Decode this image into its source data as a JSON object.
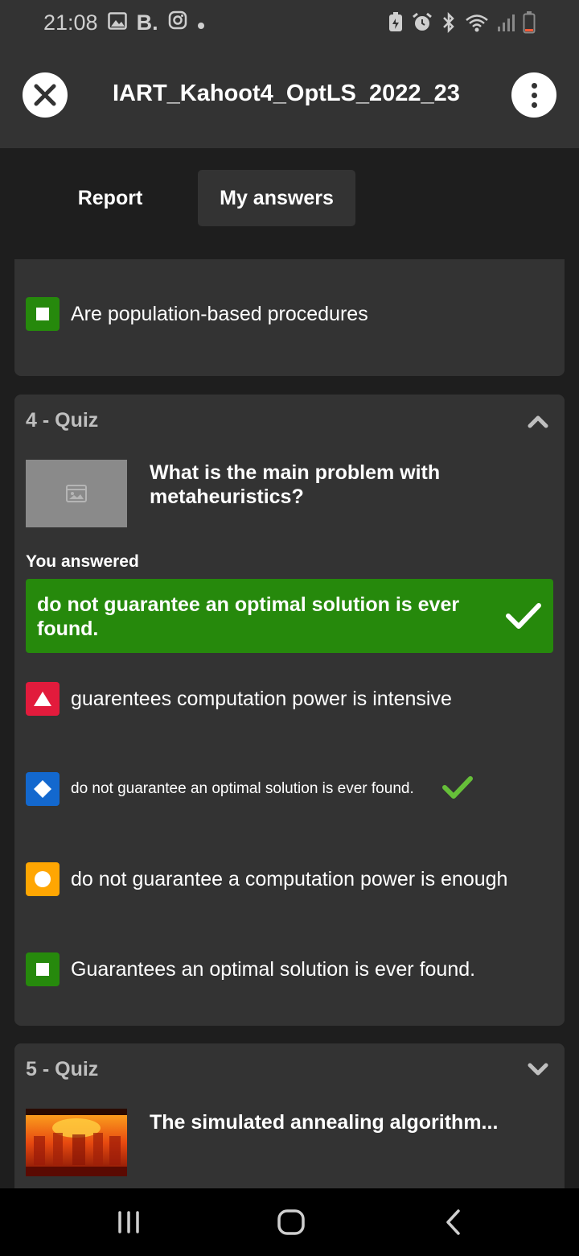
{
  "status_bar": {
    "time": "21:08",
    "b_label": "B.",
    "icons": [
      "gallery-icon",
      "b-app-icon",
      "instagram-icon",
      "notification-dot-icon",
      "battery-saver-icon",
      "alarm-icon",
      "bluetooth-icon",
      "wifi-icon",
      "signal-icon",
      "battery-icon"
    ]
  },
  "header": {
    "title": "IART_Kahoot4_OptLS_2022_23",
    "close_icon": "close-icon",
    "menu_icon": "more-vertical-icon"
  },
  "tabs": [
    {
      "label": "Report",
      "active": false
    },
    {
      "label": "My answers",
      "active": true
    }
  ],
  "previous_card": {
    "answer": {
      "shape": "square",
      "color": "#26890c",
      "text": "Are population-based procedures"
    }
  },
  "quiz4": {
    "label": "4 - Quiz",
    "expanded": true,
    "question": "What is the main problem with metaheuristics?",
    "you_answered_label": "You answered",
    "chosen_answer": "do not guarantee an optimal solution is ever found.",
    "answers": [
      {
        "shape": "triangle",
        "color": "#e21b3c",
        "text": "guarentees computation power is intensive",
        "correct": false
      },
      {
        "shape": "diamond",
        "color": "#1368ce",
        "text": "do not guarantee an optimal solution is ever found.",
        "correct": true
      },
      {
        "shape": "circle",
        "color": "#ffa602",
        "text": "do not guarantee a computation power is enough",
        "correct": false
      },
      {
        "shape": "square",
        "color": "#26890c",
        "text": "Guarantees an optimal solution is ever found.",
        "correct": false
      }
    ]
  },
  "quiz5": {
    "label": "5 - Quiz",
    "expanded": false,
    "question": "The simulated annealing algorithm..."
  },
  "colors": {
    "background": "#1e1e1e",
    "card": "#333333",
    "correct_green": "#26890c",
    "check_green": "#66bf39"
  },
  "nav_bar": {
    "icons": [
      "recent-apps-icon",
      "home-icon",
      "back-icon"
    ]
  }
}
